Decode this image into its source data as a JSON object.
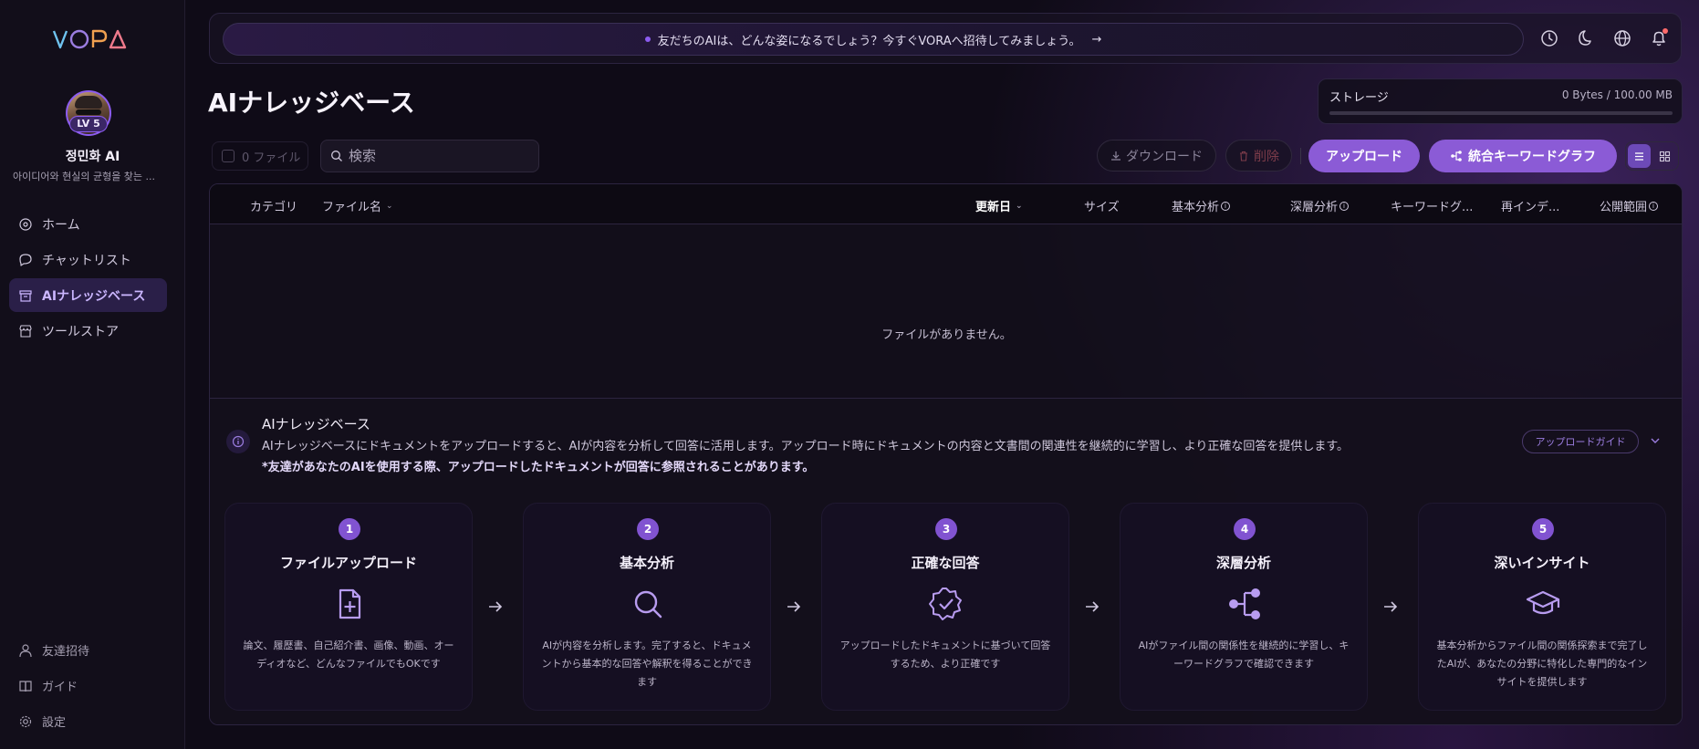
{
  "brand": {
    "logo_text": "VORA",
    "accent": "#8b5bd6"
  },
  "user": {
    "name": "정민화 AI",
    "level": "LV 5",
    "bio": "아이디어와 현실의 균형을 찾는 ..."
  },
  "sidebar": {
    "items": [
      {
        "label": "ホーム",
        "icon": "home-icon"
      },
      {
        "label": "チャットリスト",
        "icon": "chat-icon"
      },
      {
        "label": "AIナレッジベース",
        "icon": "archive-icon",
        "active": true
      },
      {
        "label": "ツールストア",
        "icon": "store-icon"
      }
    ],
    "bottom_items": [
      {
        "label": "友達招待",
        "icon": "user-icon"
      },
      {
        "label": "ガイド",
        "icon": "book-icon"
      },
      {
        "label": "設定",
        "icon": "gear-icon"
      }
    ]
  },
  "banner": {
    "text": "友だちのAIは、どんな姿になるでしょう？今すぐVORAへ招待してみましょう。",
    "arrow": "→"
  },
  "topbar": {
    "icons": [
      "clock-icon",
      "moon-icon",
      "globe-icon",
      "bell-icon"
    ]
  },
  "page": {
    "title": "AIナレッジベース"
  },
  "storage": {
    "label": "ストレージ",
    "value": "0 Bytes / 100.00 MB",
    "used_fraction": 0
  },
  "toolbar": {
    "file_count": "0 ファイル",
    "search_placeholder": "検索",
    "download_label": "ダウンロード",
    "delete_label": "削除",
    "upload_label": "アップロード",
    "graph_label": "統合キーワードグラフ",
    "view_mode": "list"
  },
  "table": {
    "columns": {
      "category": "カテゴリ",
      "filename": "ファイル名",
      "updated": "更新日",
      "size": "サイズ",
      "basic": "基本分析",
      "deep": "深層分析",
      "keyword": "キーワードグ...",
      "reindex": "再インデ...",
      "scope": "公開範囲"
    },
    "empty_text": "ファイルがありません。"
  },
  "info": {
    "title": "AIナレッジベース",
    "description": "AIナレッジベースにドキュメントをアップロードすると、AIが内容を分析して回答に活用します。アップロード時にドキュメントの内容と文書間の関連性を継続的に学習し、より正確な回答を提供します。",
    "note": "*友達があなたのAIを使用する際、アップロードしたドキュメントが回答に参照されることがあります。",
    "guide_label": "アップロードガイド"
  },
  "steps": [
    {
      "num": "1",
      "title": "ファイルアップロード",
      "icon": "file-plus-icon",
      "desc": "論文、履歴書、自己紹介書、画像、動画、オーディオなど、どんなファイルでもOKです"
    },
    {
      "num": "2",
      "title": "基本分析",
      "icon": "search-icon",
      "desc": "AIが内容を分析します。完了すると、ドキュメントから基本的な回答や解釈を得ることができます"
    },
    {
      "num": "3",
      "title": "正確な回答",
      "icon": "badge-check-icon",
      "desc": "アップロードしたドキュメントに基づいて回答するため、より正確です"
    },
    {
      "num": "4",
      "title": "深層分析",
      "icon": "share-icon",
      "desc": "AIがファイル間の関係性を継続的に学習し、キーワードグラフで確認できます"
    },
    {
      "num": "5",
      "title": "深いインサイト",
      "icon": "graduation-cap-icon",
      "desc": "基本分析からファイル間の関係探索まで完了したAIが、あなたの分野に特化した専門的なインサイトを提供します"
    }
  ]
}
